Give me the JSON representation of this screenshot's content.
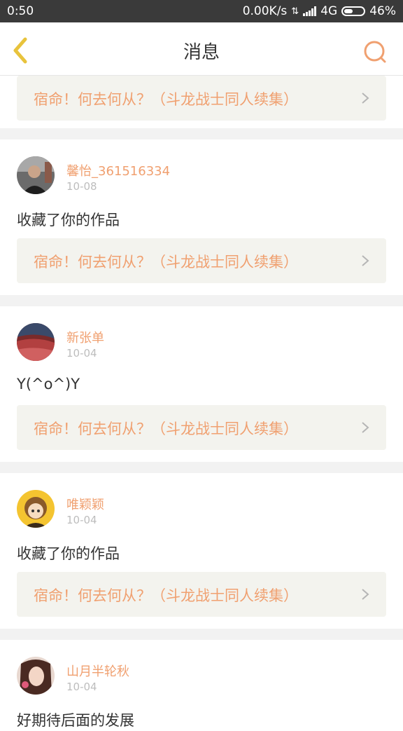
{
  "status_bar": {
    "time": "0:50",
    "speed": "0.00K/s",
    "network": "4G",
    "battery": "46%",
    "battery_level": 0.46
  },
  "nav": {
    "title": "消息",
    "back_icon": "chevron-left-icon",
    "search_icon": "search-icon"
  },
  "colors": {
    "accent": "#f0a070",
    "back_icon": "#e8c33c"
  },
  "feed": {
    "top_partial": {
      "work_title": "宿命！何去何从？（斗龙战士同人续集）"
    },
    "items": [
      {
        "username": "馨怡_361516334",
        "date": "10-08",
        "comment": "收藏了你的作品",
        "work_title": "宿命！何去何从？（斗龙战士同人续集）"
      },
      {
        "username": "新张单",
        "date": "10-04",
        "comment": "Y(^o^)Y",
        "work_title": "宿命！何去何从？（斗龙战士同人续集）"
      },
      {
        "username": "唯颖颖",
        "date": "10-04",
        "comment": "收藏了你的作品",
        "work_title": "宿命！何去何从？（斗龙战士同人续集）"
      },
      {
        "username": "山月半轮秋",
        "date": "10-04",
        "comment": "好期待后面的发展"
      }
    ]
  }
}
